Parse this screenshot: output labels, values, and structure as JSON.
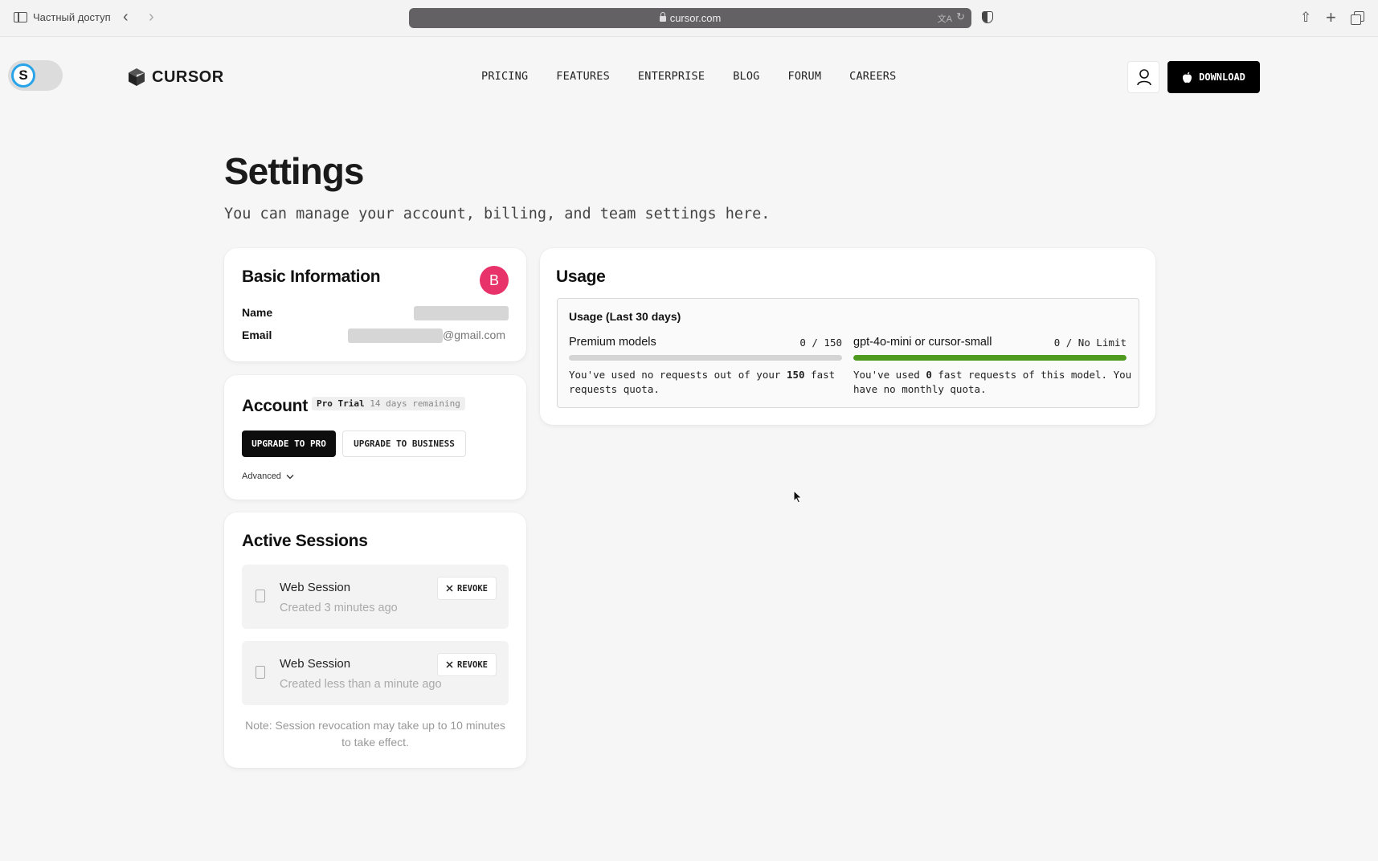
{
  "browser": {
    "private_label": "Частный доступ",
    "url": "cursor.com"
  },
  "extension": {
    "initial": "S"
  },
  "site": {
    "brand": "CURSOR",
    "nav": [
      "PRICING",
      "FEATURES",
      "ENTERPRISE",
      "BLOG",
      "FORUM",
      "CAREERS"
    ],
    "download_label": "DOWNLOAD"
  },
  "settings": {
    "title": "Settings",
    "subtitle": "You can manage your account, billing, and team settings here."
  },
  "basic_info": {
    "title": "Basic Information",
    "avatar_initial": "B",
    "avatar_color": "#e8336a",
    "name_label": "Name",
    "email_label": "Email",
    "email_suffix": "@gmail.com"
  },
  "account": {
    "title": "Account",
    "plan": "Pro Trial",
    "days_remaining": "14 days remaining",
    "upgrade_pro": "UPGRADE TO PRO",
    "upgrade_business": "UPGRADE TO BUSINESS",
    "advanced": "Advanced"
  },
  "sessions": {
    "title": "Active Sessions",
    "revoke_label": "REVOKE",
    "items": [
      {
        "name": "Web Session",
        "created": "Created 3 minutes ago"
      },
      {
        "name": "Web Session",
        "created": "Created less than a minute ago"
      }
    ],
    "note": "Note: Session revocation may take up to 10 minutes to take effect."
  },
  "usage": {
    "title": "Usage",
    "box_title": "Usage (Last 30 days)",
    "models": [
      {
        "name": "Premium models",
        "count": "0 / 150",
        "fill_fraction": 0,
        "bar_color": "#d4d4d4",
        "desc_pre": "You've used no requests out of your ",
        "desc_bold": "150",
        "desc_post": " fast requests quota."
      },
      {
        "name": "gpt-4o-mini or cursor-small",
        "count": "0 / No Limit",
        "fill_fraction": 1,
        "bar_color": "#4e9a1e",
        "desc_pre": "You've used ",
        "desc_bold": "0",
        "desc_post": " fast requests of this model. You have no monthly quota."
      }
    ]
  }
}
